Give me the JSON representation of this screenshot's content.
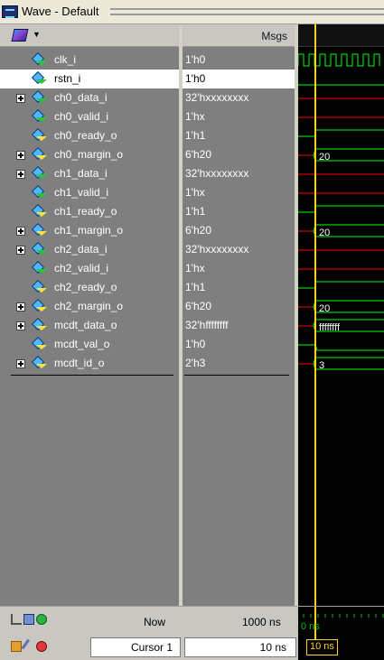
{
  "window": {
    "title": "Wave - Default"
  },
  "values_header": "Msgs",
  "signals": [
    {
      "name": "clk_i",
      "value": "1'h0",
      "expandable": false,
      "dir": "in"
    },
    {
      "name": "rstn_i",
      "value": "1'h0",
      "expandable": false,
      "dir": "in",
      "selected": true
    },
    {
      "name": "ch0_data_i",
      "value": "32'hxxxxxxxx",
      "expandable": true,
      "dir": "in"
    },
    {
      "name": "ch0_valid_i",
      "value": "1'hx",
      "expandable": false,
      "dir": "in"
    },
    {
      "name": "ch0_ready_o",
      "value": "1'h1",
      "expandable": false,
      "dir": "out"
    },
    {
      "name": "ch0_margin_o",
      "value": "6'h20",
      "expandable": true,
      "dir": "out"
    },
    {
      "name": "ch1_data_i",
      "value": "32'hxxxxxxxx",
      "expandable": true,
      "dir": "in"
    },
    {
      "name": "ch1_valid_i",
      "value": "1'hx",
      "expandable": false,
      "dir": "in"
    },
    {
      "name": "ch1_ready_o",
      "value": "1'h1",
      "expandable": false,
      "dir": "out"
    },
    {
      "name": "ch1_margin_o",
      "value": "6'h20",
      "expandable": true,
      "dir": "out"
    },
    {
      "name": "ch2_data_i",
      "value": "32'hxxxxxxxx",
      "expandable": true,
      "dir": "in"
    },
    {
      "name": "ch2_valid_i",
      "value": "1'hx",
      "expandable": false,
      "dir": "in"
    },
    {
      "name": "ch2_ready_o",
      "value": "1'h1",
      "expandable": false,
      "dir": "out"
    },
    {
      "name": "ch2_margin_o",
      "value": "6'h20",
      "expandable": true,
      "dir": "out"
    },
    {
      "name": "mcdt_data_o",
      "value": "32'hffffffff",
      "expandable": true,
      "dir": "out"
    },
    {
      "name": "mcdt_val_o",
      "value": "1'h0",
      "expandable": false,
      "dir": "out"
    },
    {
      "name": "mcdt_id_o",
      "value": "2'h3",
      "expandable": true,
      "dir": "out"
    }
  ],
  "wave_labels": {
    "ch0_margin_o": "20",
    "ch1_margin_o": "20",
    "ch2_margin_o": "20",
    "mcdt_data_o": "ffffffff",
    "mcdt_id_o": "3"
  },
  "footer": {
    "now_label": "Now",
    "now_value": "1000 ns",
    "cursor_label": "Cursor 1",
    "cursor_value": "10 ns",
    "cursor_flag": "10 ns",
    "ruler_label": "0 ns"
  },
  "colors": {
    "background": "#000000",
    "clock": "#00ff00",
    "x_state": "#ff0000",
    "cursor": "#ffd21e",
    "bus": "#00ff00"
  }
}
